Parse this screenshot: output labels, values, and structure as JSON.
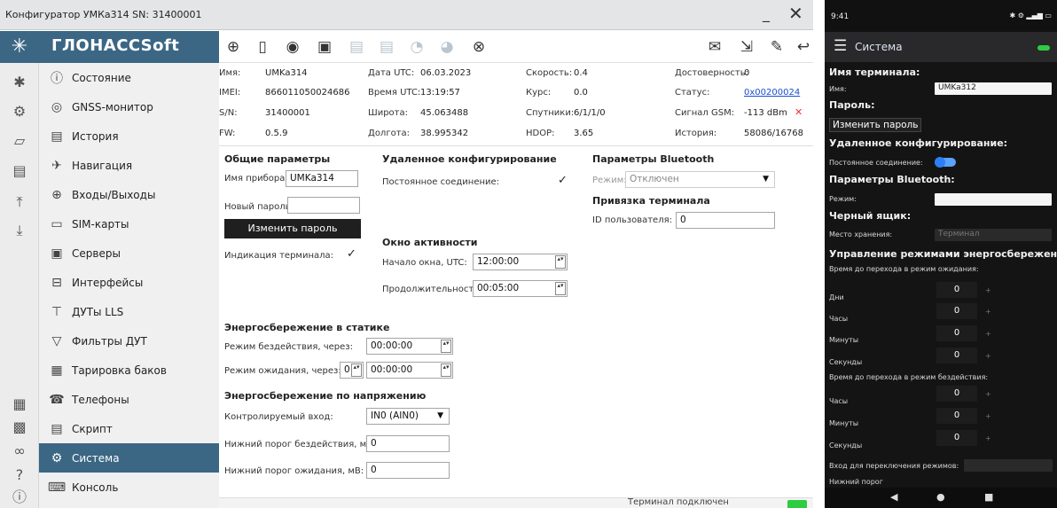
{
  "window": {
    "title": "Конфигуратор УМКа314 SN: 31400001",
    "minimize": "_",
    "close": "✕"
  },
  "brand": {
    "name": "ГЛОНАССSoft"
  },
  "toolbar": {
    "icons": [
      "write-config-icon",
      "device-icon",
      "connect-wireless-icon",
      "read-device-icon",
      "load-icon",
      "save-icon",
      "db-icon",
      "db-settings-icon",
      "location-off-icon",
      "mail-icon",
      "export-icon",
      "sign-icon",
      "reply-icon"
    ]
  },
  "nav": {
    "items": [
      {
        "label": "Состояние",
        "icon": "ⓘ"
      },
      {
        "label": "GNSS-монитор",
        "icon": "◎"
      },
      {
        "label": "История",
        "icon": "▤"
      },
      {
        "label": "Навигация",
        "icon": "✈"
      },
      {
        "label": "Входы/Выходы",
        "icon": "⊕"
      },
      {
        "label": "SIM-карты",
        "icon": "▭"
      },
      {
        "label": "Серверы",
        "icon": "▣"
      },
      {
        "label": "Интерфейсы",
        "icon": "⊟"
      },
      {
        "label": "ДУТы LLS",
        "icon": "⊤"
      },
      {
        "label": "Фильтры ДУТ",
        "icon": "▽"
      },
      {
        "label": "Тарировка баков",
        "icon": "▦"
      },
      {
        "label": "Телефоны",
        "icon": "☎"
      },
      {
        "label": "Скрипт",
        "icon": "▤"
      },
      {
        "label": "Система",
        "icon": "⚙"
      },
      {
        "label": "Консоль",
        "icon": "⌨"
      }
    ],
    "active_index": 13
  },
  "info": {
    "name_label": "Имя:",
    "name": "UMKa314",
    "imei_label": "IMEI:",
    "imei": "866011050024686",
    "sn_label": "S/N:",
    "sn": "31400001",
    "fw_label": "FW:",
    "fw": "0.5.9",
    "date_label": "Дата UTC:",
    "date": "06.03.2023",
    "time_label": "Время UTC:",
    "time": "13:19:57",
    "lat_label": "Широта:",
    "lat": "45.063488",
    "lon_label": "Долгота:",
    "lon": "38.995342",
    "speed_label": "Скорость:",
    "speed": "0.4",
    "course_label": "Курс:",
    "course": "0.0",
    "sats_label": "Спутники:",
    "sats": "6/1/1/0",
    "hdop_label": "HDOP:",
    "hdop": "3.65",
    "valid_label": "Достоверность:",
    "valid": "0",
    "status_label": "Статус:",
    "status": "0x00200024",
    "gsm_label": "Сигнал GSM:",
    "gsm": "-113 dBm",
    "history_label": "История:",
    "history": "58086/16768"
  },
  "general": {
    "title": "Общие параметры",
    "device_name_label": "Имя прибора:",
    "device_name": "UMKa314",
    "new_password_label": "Новый пароль:",
    "new_password": "",
    "change_password": "Изменить пароль",
    "indication_label": "Индикация терминала:",
    "indication_checked": true
  },
  "remote": {
    "title": "Удаленное конфигурирование",
    "persistent_label": "Постоянное соединение:",
    "persistent_checked": true
  },
  "activity": {
    "title": "Окно активности",
    "start_label": "Начало окна, UTC:",
    "start": "12:00:00",
    "duration_label": "Продолжительность:",
    "duration": "00:05:00"
  },
  "bluetooth": {
    "title": "Параметры Bluetooth",
    "mode_label": "Режим:",
    "mode": "Отключен"
  },
  "binding": {
    "title": "Привязка терминала",
    "user_id_label": "ID пользователя:",
    "user_id": "0"
  },
  "static_save": {
    "title": "Энергосбережение в статике",
    "idle_label": "Режим бездействия, через:",
    "idle": "00:00:00",
    "standby_label": "Режим ожидания, через:",
    "standby_days": "0",
    "standby": "00:00:00"
  },
  "voltage_save": {
    "title": "Энергосбережение по напряжению",
    "input_label": "Контролируемый вход:",
    "input": "IN0 (AIN0)",
    "idle_thr_label": "Нижний порог бездействия, мВ:",
    "idle_thr": "0",
    "standby_thr_label": "Нижний порог ожидания, мВ:",
    "standby_thr": "0"
  },
  "footer": {
    "status": "Терминал подключен",
    "status_color": "#2ecc40"
  },
  "mobile": {
    "time": "9:41",
    "status_icons": "✱ ⚙ ▂▄▆ ▭",
    "title": "Система",
    "terminal_name_h": "Имя терминала:",
    "name_label": "Имя:",
    "name": "UMKa312",
    "password_h": "Пароль:",
    "change_password": "Изменить пароль",
    "remote_h": "Удаленное конфигурирование:",
    "persistent_label": "Постоянное соединение:",
    "bt_h": "Параметры Bluetooth:",
    "mode_label": "Режим:",
    "blackbox_h": "Черный ящик:",
    "storage_label": "Место хранения:",
    "storage": "Терминал",
    "power_h": "Управление режимами энергосбережения:",
    "to_standby_label": "Время до перехода в режим ожидания:",
    "days_label": "Дни",
    "days": "0",
    "hours_label": "Часы",
    "hours": "0",
    "minutes_label": "Минуты",
    "minutes": "0",
    "seconds_label": "Секунды",
    "seconds": "0",
    "to_idle_label": "Время до перехода в режим бездействия:",
    "idle_hours_label": "Часы",
    "idle_hours": "0",
    "idle_minutes_label": "Минуты",
    "idle_minutes": "0",
    "idle_seconds_label": "Секунды",
    "idle_seconds": "0",
    "switch_input_label": "Вход для переключения режимов:",
    "lower_threshold_label": "Нижний порог",
    "nav_back": "◀",
    "nav_home": "●",
    "nav_recent": "■"
  }
}
